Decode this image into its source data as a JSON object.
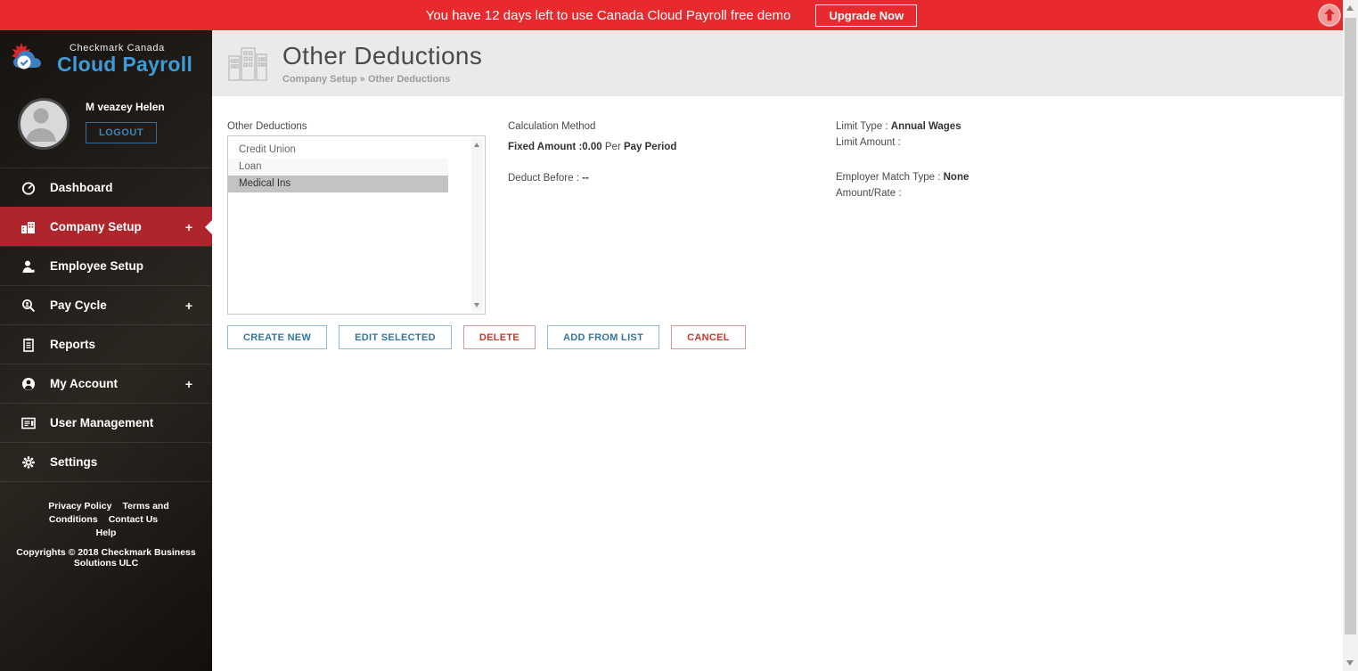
{
  "banner": {
    "message": "You have 12 days left to use Canada Cloud Payroll free demo",
    "upgrade_label": "Upgrade Now",
    "bg_color": "#e8292d"
  },
  "sidebar": {
    "brand": {
      "top": "Checkmark Canada",
      "bottom": "Cloud Payroll"
    },
    "user": {
      "name": "M veazey Helen",
      "logout_label": "LOGOUT"
    },
    "menu": [
      {
        "label": "Dashboard",
        "icon": "dashboard-icon",
        "plus": "",
        "active": false
      },
      {
        "label": "Company Setup",
        "icon": "company-setup-icon",
        "plus": "+",
        "active": true
      },
      {
        "label": "Employee Setup",
        "icon": "employee-setup-icon",
        "plus": "",
        "active": false
      },
      {
        "label": "Pay Cycle",
        "icon": "pay-cycle-icon",
        "plus": "+",
        "active": false
      },
      {
        "label": "Reports",
        "icon": "reports-icon",
        "plus": "",
        "active": false
      },
      {
        "label": "My Account",
        "icon": "my-account-icon",
        "plus": "+",
        "active": false
      },
      {
        "label": "User Management",
        "icon": "user-management-icon",
        "plus": "",
        "active": false
      },
      {
        "label": "Settings",
        "icon": "settings-icon",
        "plus": "",
        "active": false
      }
    ],
    "footer_links": [
      "Privacy Policy",
      "Terms and Conditions",
      "Contact Us",
      "Help"
    ],
    "copyright": "Copyrights © 2018 Checkmark Business Solutions ULC"
  },
  "header": {
    "title": "Other Deductions",
    "breadcrumb": "Company Setup » Other Deductions"
  },
  "content": {
    "list_label": "Other Deductions",
    "list_items": [
      {
        "name": "Credit Union",
        "selected": false
      },
      {
        "name": "Loan",
        "selected": false
      },
      {
        "name": "Medical Ins",
        "selected": true
      }
    ],
    "details": {
      "calculation_method_label": "Calculation Method",
      "fixed_amount_label": "Fixed Amount",
      "fixed_amount_value": ":0.00",
      "per_label": "Per",
      "per_value": "Pay Period",
      "deduct_before_label": "Deduct Before :",
      "deduct_before_value": "--",
      "limit_type_label": "Limit Type :",
      "limit_type_value": "Annual Wages",
      "limit_amount_label": "Limit Amount :",
      "employer_match_label": "Employer Match Type :",
      "employer_match_value": "None",
      "amount_rate_label": "Amount/Rate :"
    },
    "buttons": [
      {
        "label": "CREATE NEW",
        "style": "blue"
      },
      {
        "label": "EDIT SELECTED",
        "style": "blue"
      },
      {
        "label": "DELETE",
        "style": "red"
      },
      {
        "label": "ADD FROM LIST",
        "style": "blue"
      },
      {
        "label": "CANCEL",
        "style": "red"
      }
    ]
  },
  "colors": {
    "banner_red": "#e8292d",
    "active_menu_red": "#b0252b",
    "brand_blue": "#3e9bd8",
    "button_blue": "#34759f",
    "button_red": "#c0392b",
    "header_band": "#eaeaea",
    "selected_row": "#c3c3c3"
  }
}
